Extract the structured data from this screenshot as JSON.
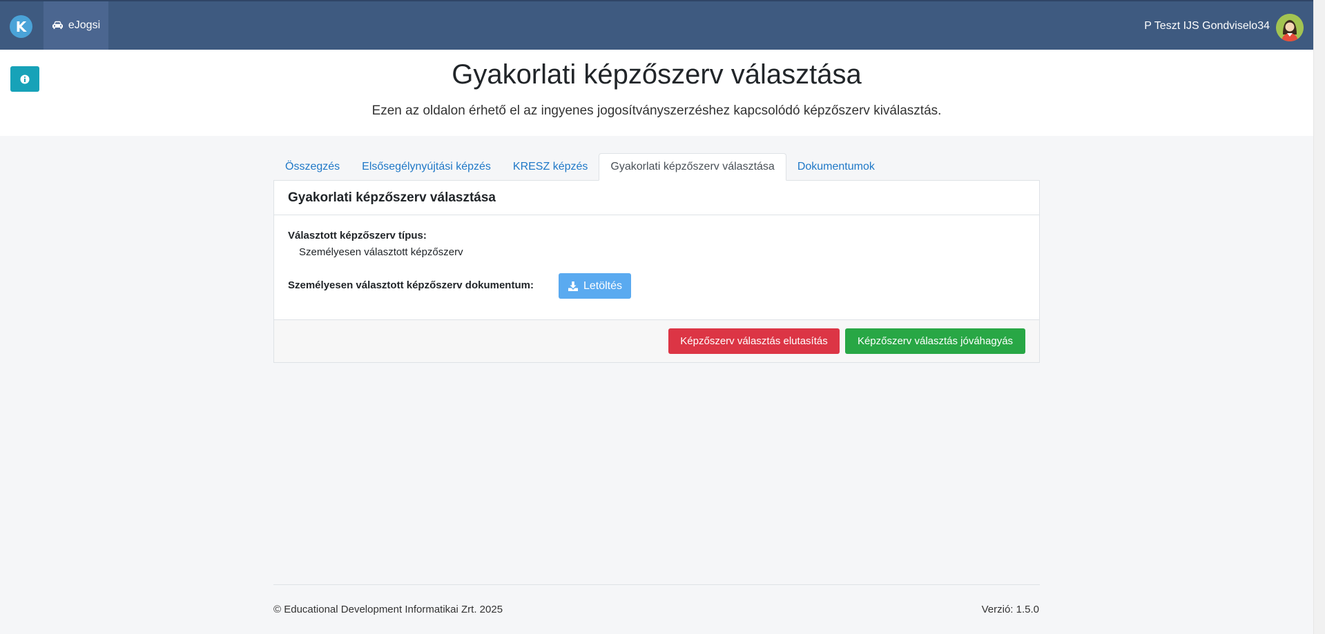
{
  "navbar": {
    "logo_letter": "K",
    "app_label": "eJogsi",
    "user_name": "P Teszt IJS Gondviselo34"
  },
  "header": {
    "title": "Gyakorlati képzőszerv választása",
    "subtitle": "Ezen az oldalon érhető el az ingyenes jogosítványszerzéshez kapcsolódó képzőszerv kiválasztás."
  },
  "tabs": [
    {
      "label": "Összegzés"
    },
    {
      "label": "Elsősegélynyújtási képzés"
    },
    {
      "label": "KRESZ képzés"
    },
    {
      "label": "Gyakorlati képzőszerv választása"
    },
    {
      "label": "Dokumentumok"
    }
  ],
  "card": {
    "title": "Gyakorlati képzőszerv választása",
    "type_label": "Választott képzőszerv típus:",
    "type_value": "Személyesen választott képzőszerv",
    "document_label": "Személyesen választott képzőszerv dokumentum:",
    "download_label": "Letöltés",
    "reject_label": "Képzőszerv választás elutasítás",
    "approve_label": "Képzőszerv választás jóváhagyás"
  },
  "footer": {
    "copyright": "© Educational Development Informatikai Zrt. 2025",
    "version": "Verzió: 1.5.0"
  },
  "colors": {
    "navbar": "#3e5a80",
    "info": "#17a2b8",
    "download": "#5aaaf0",
    "reject": "#dc3545",
    "approve": "#28a745",
    "link": "#1f78c7"
  }
}
